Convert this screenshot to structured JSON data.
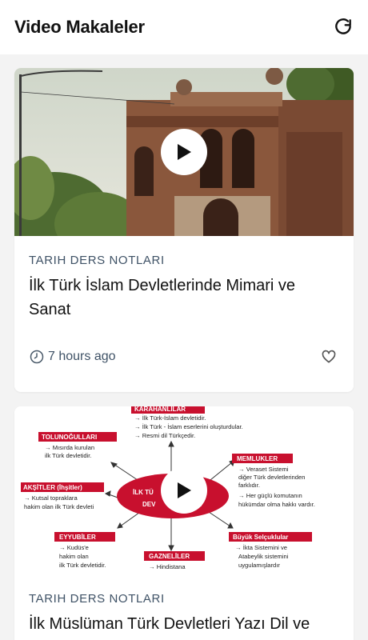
{
  "appbar": {
    "title": "Video Makaleler",
    "refresh_icon": "refresh-icon"
  },
  "colors": {
    "appbar_bg": "#ffffff",
    "page_bg": "#f3f3f3",
    "category_text": "#3f5266",
    "diagram_red": "#c8102e"
  },
  "articles": [
    {
      "category": "TARIH DERS NOTLARI",
      "title": "İlk Türk İslam Devletlerinde Mimari ve Sanat",
      "time": "7 hours ago",
      "thumbnail": "historic-brick-building-photo",
      "icons": {
        "play": "play-icon",
        "clock": "clock-icon",
        "favorite": "heart-icon"
      }
    },
    {
      "category": "TARIH DERS NOTLARI",
      "title": "İlk Müslüman Türk Devletleri Yazı Dil ve",
      "thumbnail": "mindmap-diagram",
      "diagram": {
        "center": "İLK TÜRK İSLAM DEVLETLERİ",
        "center_line1": "İLK TÜ",
        "center_line2": "DEV",
        "center_right1": "İ",
        "center_right2": "İ",
        "nodes": {
          "karahanlilar": {
            "label": "KARAHANLILAR",
            "lines": [
              "→ İlk Türk-İslam devletidir.",
              "→ İlk Türk - İslam eserlerini oluşturdular.",
              "→ Resmi dil Türkçedir."
            ]
          },
          "tolunogullari": {
            "label": "TOLUNOĞULLARI",
            "lines": [
              "→ Mısırda kurulan",
              "ilk Türk devletidir."
            ]
          },
          "memlukler": {
            "label": "MEMLUKLER",
            "lines": [
              "→ Veraset Sistemi",
              "diğer Türk devletlerinden",
              "farklıdır.",
              "→ Her güçlü komutanın",
              "hükümdar olma hakkı vardır."
            ]
          },
          "aksitler": {
            "label": "AKŞİTLER (İhşitler)",
            "lines": [
              "→ Kutsal topraklara",
              "hakim olan ilk Türk devleti"
            ]
          },
          "eyyubiler": {
            "label": "EYYUBİLER",
            "lines": [
              "→ Kudüs'e",
              "hakim olan",
              "ilk Türk devletidir."
            ]
          },
          "gazneliler": {
            "label": "GAZNELİLER",
            "lines": [
              "→ Hindistana"
            ]
          },
          "buyuk_selcuklular": {
            "label": "Büyük Selçuklular",
            "lines": [
              "→ İkta Sistemini ve",
              "Atabeylik sistemini",
              "uygulamışlardır"
            ]
          }
        }
      },
      "icons": {
        "play": "play-icon"
      }
    }
  ]
}
